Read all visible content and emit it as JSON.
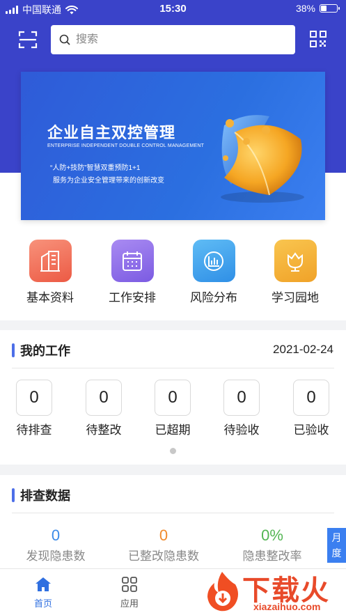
{
  "status_bar": {
    "carrier": "中国联通",
    "time": "15:30",
    "battery": "38%",
    "battery_level": 0.38
  },
  "search": {
    "placeholder": "搜索"
  },
  "banner": {
    "title": "企业自主双控管理",
    "subtitle": "ENTERPRISE INDEPENDENT DOUBLE CONTROL MANAGEMENT",
    "line1": "“人防+技防”智慧双重预防1+1",
    "line2": "服务为企业安全管理带来的创新改变"
  },
  "menu": [
    {
      "label": "基本资料",
      "icon": "building-icon",
      "color": "#f0705a"
    },
    {
      "label": "工作安排",
      "icon": "calendar-icon",
      "color": "#8f6ee8"
    },
    {
      "label": "风险分布",
      "icon": "chart-icon",
      "color": "#3fa6ee"
    },
    {
      "label": "学习园地",
      "icon": "flower-icon",
      "color": "#f5b63a"
    }
  ],
  "my_work": {
    "title": "我的工作",
    "date": "2021-02-24",
    "items": [
      {
        "value": "0",
        "label": "待排查"
      },
      {
        "value": "0",
        "label": "待整改"
      },
      {
        "value": "0",
        "label": "已超期"
      },
      {
        "value": "0",
        "label": "待验收"
      },
      {
        "value": "0",
        "label": "已验收"
      }
    ]
  },
  "inspection": {
    "title": "排查数据",
    "stats": [
      {
        "value": "0",
        "label": "发现隐患数",
        "color": "#3b8be8"
      },
      {
        "value": "0",
        "label": "已整改隐患数",
        "color": "#f08a2c"
      },
      {
        "value": "0%",
        "label": "隐患整改率",
        "color": "#52b552"
      }
    ]
  },
  "side_tab": {
    "line1": "月",
    "line2": "度"
  },
  "tabbar": {
    "home": "首页",
    "apps": "应用",
    "active_color": "#2f6fe0"
  },
  "watermark": {
    "brand": "下载火",
    "url": "xiazaihuo.com"
  }
}
